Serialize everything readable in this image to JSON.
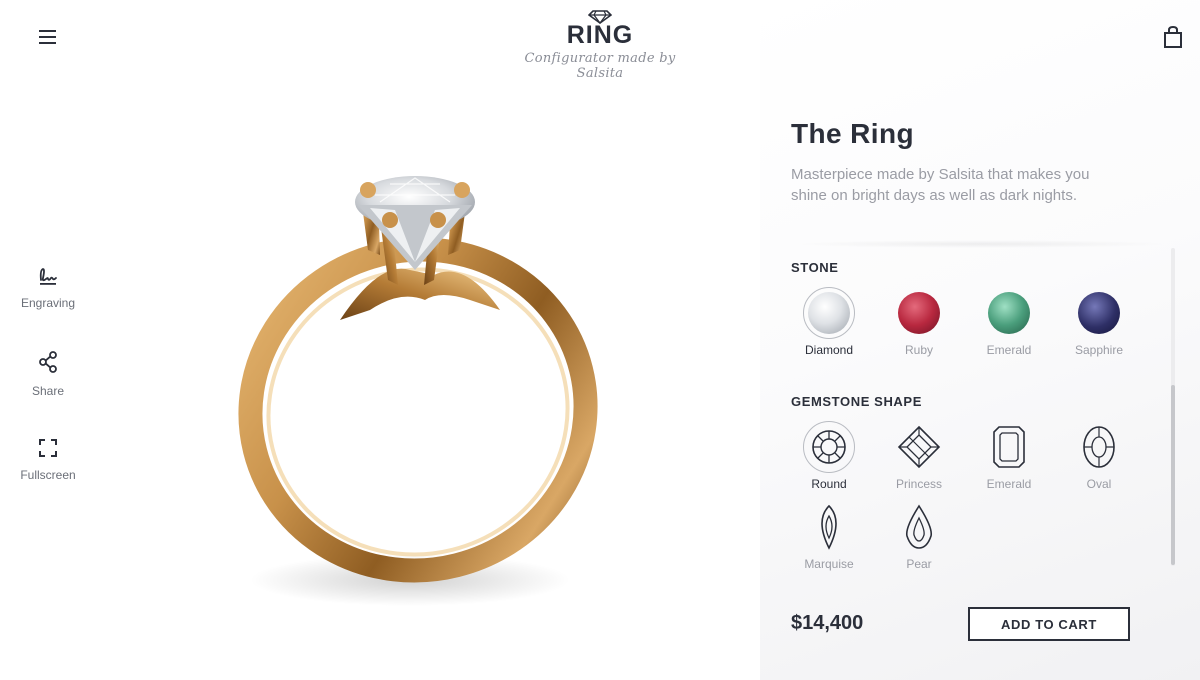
{
  "header": {
    "logo_name": "RING",
    "logo_tagline": "Configurator made by Salsita",
    "menu_icon": "hamburger-menu-icon",
    "cart_icon": "shopping-bag-icon"
  },
  "tools": [
    {
      "label": "Engraving",
      "icon": "engraving-signature-icon"
    },
    {
      "label": "Share",
      "icon": "share-icon"
    },
    {
      "label": "Fullscreen",
      "icon": "fullscreen-icon"
    }
  ],
  "product": {
    "title": "The Ring",
    "description": "Masterpiece made by Salsita that makes you shine on bright days as well as dark nights.",
    "price": "$14,400",
    "add_to_cart_label": "ADD TO CART",
    "metal_color": "#c8914a"
  },
  "stone": {
    "title": "STONE",
    "selected": "Diamond",
    "options": [
      {
        "label": "Diamond",
        "color": "#e6e8ec"
      },
      {
        "label": "Ruby",
        "color": "#b8283f"
      },
      {
        "label": "Emerald",
        "color": "#4a9e7c"
      },
      {
        "label": "Sapphire",
        "color": "#2e2f66"
      }
    ]
  },
  "shape": {
    "title": "GEMSTONE SHAPE",
    "selected": "Round",
    "options": [
      {
        "label": "Round",
        "icon": "round-cut-icon"
      },
      {
        "label": "Princess",
        "icon": "princess-cut-icon"
      },
      {
        "label": "Emerald",
        "icon": "emerald-cut-icon"
      },
      {
        "label": "Oval",
        "icon": "oval-cut-icon"
      },
      {
        "label": "Marquise",
        "icon": "marquise-cut-icon"
      },
      {
        "label": "Pear",
        "icon": "pear-cut-icon"
      }
    ]
  }
}
